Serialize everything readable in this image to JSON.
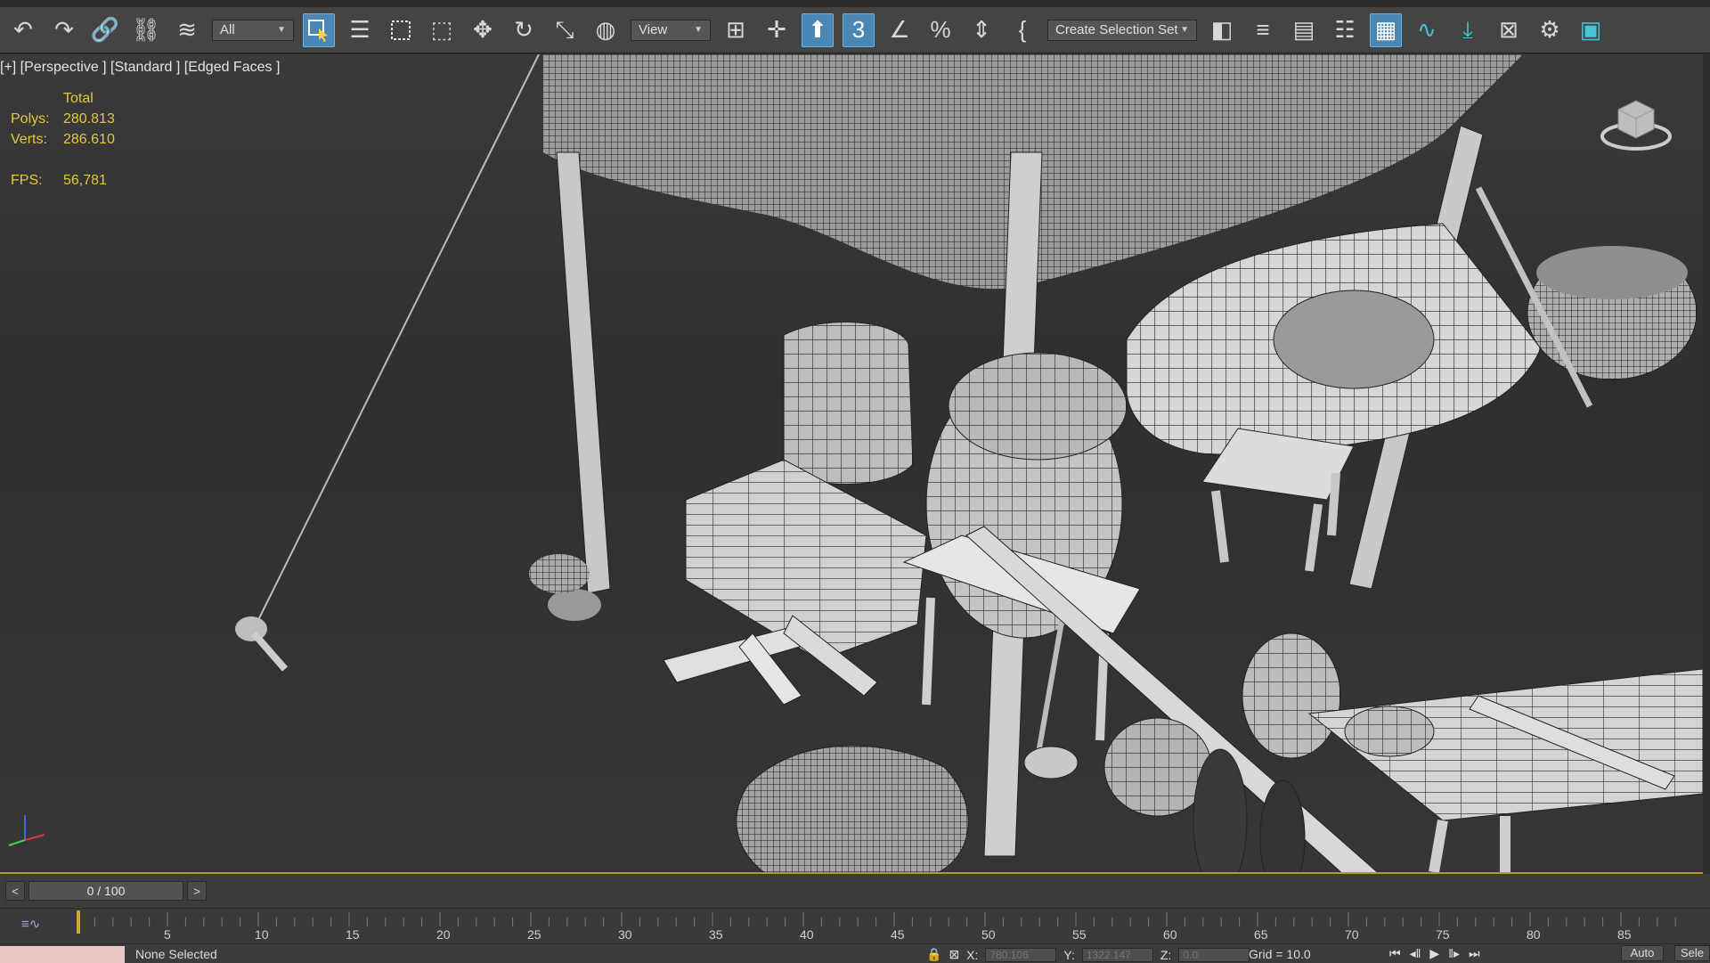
{
  "toolbar": {
    "selection_filter": "All",
    "reference_coord": "View",
    "selection_set": "Create Selection Set",
    "colors": {
      "active": "#4a87b4",
      "bg": "#444444"
    }
  },
  "viewport": {
    "label": "[+] [Perspective ] [Standard ] [Edged Faces ]",
    "stats_header": "Total",
    "polys_label": "Polys:",
    "polys_value": "280.813",
    "verts_label": "Verts:",
    "verts_value": "286.610",
    "fps_label": "FPS:",
    "fps_value": "56,781",
    "stats_color": "#e2c93c"
  },
  "timeline": {
    "prev": "<",
    "frame": "0 / 100",
    "next": ">",
    "ticks": [
      "5",
      "10",
      "15",
      "20",
      "25",
      "30",
      "35",
      "40",
      "45",
      "50",
      "55",
      "60",
      "65",
      "70",
      "75",
      "80",
      "85"
    ]
  },
  "status": {
    "selection": "None Selected",
    "x_label": "X:",
    "y_label": "Y:",
    "z_label": "Z:",
    "x_value": "780.106",
    "y_value": "1322.147",
    "z_value": "0.0",
    "grid": "Grid = 10.0",
    "auto": "Auto",
    "sel": "Sele"
  }
}
